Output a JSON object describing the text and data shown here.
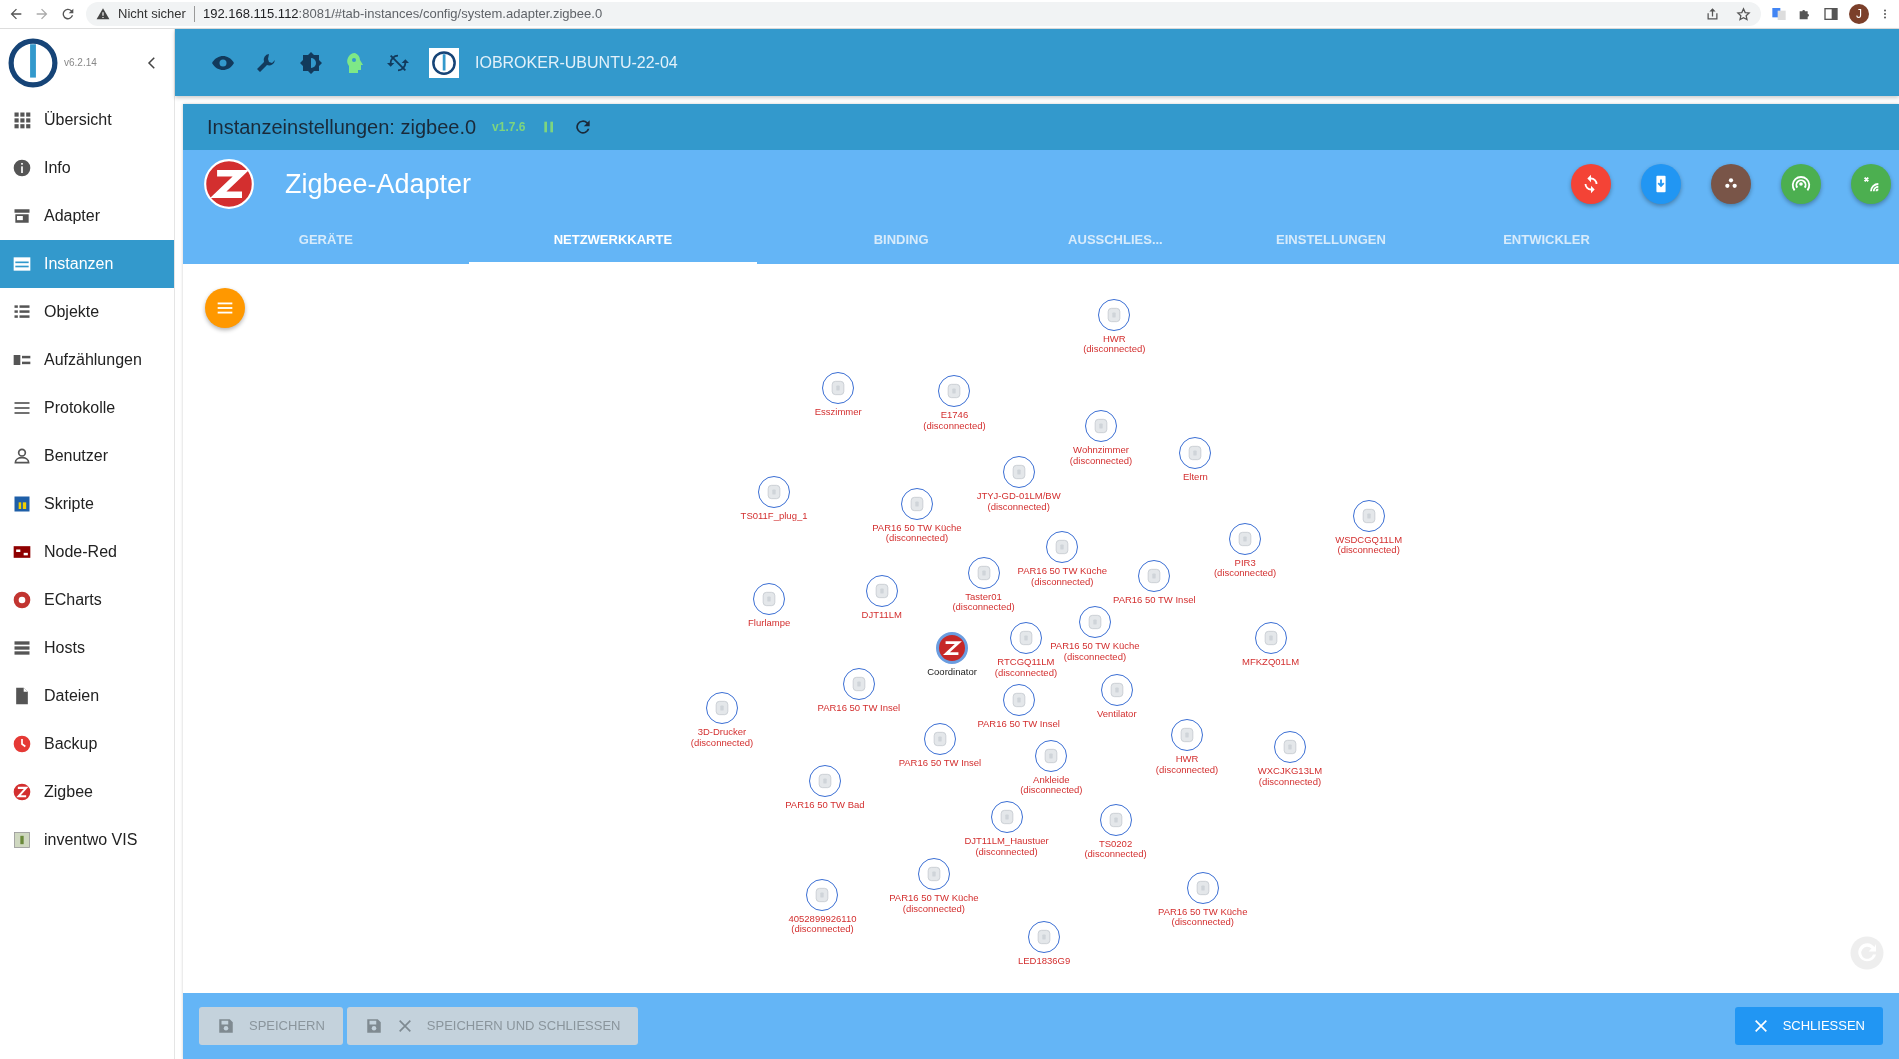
{
  "browser": {
    "security": "Nicht sicher",
    "url_host": "192.168.115.112",
    "url_path": ":8081/#tab-instances/config/system.adapter.zigbee.0",
    "profile_initial": "J"
  },
  "sidebar": {
    "version": "v6.2.14",
    "items": [
      {
        "label": "Übersicht",
        "selected": false
      },
      {
        "label": "Info",
        "selected": false
      },
      {
        "label": "Adapter",
        "selected": false
      },
      {
        "label": "Instanzen",
        "selected": true
      },
      {
        "label": "Objekte",
        "selected": false
      },
      {
        "label": "Aufzählungen",
        "selected": false
      },
      {
        "label": "Protokolle",
        "selected": false
      },
      {
        "label": "Benutzer",
        "selected": false
      },
      {
        "label": "Skripte",
        "selected": false
      },
      {
        "label": "Node-Red",
        "selected": false
      },
      {
        "label": "ECharts",
        "selected": false
      },
      {
        "label": "Hosts",
        "selected": false
      },
      {
        "label": "Dateien",
        "selected": false
      },
      {
        "label": "Backup",
        "selected": false
      },
      {
        "label": "Zigbee",
        "selected": false
      },
      {
        "label": "inventwo VIS",
        "selected": false
      }
    ]
  },
  "toolbar": {
    "host": "IOBROKER-UBUNTU-22-04"
  },
  "instance": {
    "title": "Instanzeinstellungen: zigbee.0",
    "version": "v1.7.6"
  },
  "adapter": {
    "title": "Zigbee-Adapter",
    "actions": [
      {
        "color": "#f44336"
      },
      {
        "color": "#2196f3"
      },
      {
        "color": "#795548"
      },
      {
        "color": "#4caf50"
      },
      {
        "color": "#4caf50"
      }
    ],
    "tabs": [
      {
        "label": "GERÄTE",
        "selected": false
      },
      {
        "label": "NETZWERKKARTE",
        "selected": true
      },
      {
        "label": "BINDING",
        "selected": false
      },
      {
        "label": "AUSSCHLIES...",
        "selected": false
      },
      {
        "label": "EINSTELLUNGEN",
        "selected": false
      },
      {
        "label": "ENTWICKLER",
        "selected": false
      }
    ]
  },
  "map": {
    "nodes": [
      {
        "kind": "device",
        "name": "HWR",
        "status": "(disconnected)"
      },
      {
        "kind": "device",
        "name": "Esszimmer"
      },
      {
        "kind": "device",
        "name": "E1746",
        "status": "(disconnected)"
      },
      {
        "kind": "device",
        "name": "Wohnzimmer",
        "status": "(disconnected)"
      },
      {
        "kind": "device",
        "name": "Eltern"
      },
      {
        "kind": "device",
        "name": "JTYJ-GD-01LM/BW",
        "status": "(disconnected)"
      },
      {
        "kind": "device",
        "name": "TS011F_plug_1"
      },
      {
        "kind": "device",
        "name": "PAR16 50 TW Küche",
        "status": "(disconnected)"
      },
      {
        "kind": "device",
        "name": "WSDCGQ11LM",
        "status": "(disconnected)"
      },
      {
        "kind": "device",
        "name": "PIR3",
        "status": "(disconnected)"
      },
      {
        "kind": "device",
        "name": "PAR16 50 TW Küche",
        "status": "(disconnected)"
      },
      {
        "kind": "device",
        "name": "Taster01",
        "status": "(disconnected)"
      },
      {
        "kind": "device",
        "name": "PAR16 50 TW Insel"
      },
      {
        "kind": "device",
        "name": "Flurlampe"
      },
      {
        "kind": "device",
        "name": "DJT11LM"
      },
      {
        "kind": "device",
        "name": "PAR16 50 TW Küche",
        "status": "(disconnected)"
      },
      {
        "kind": "device",
        "name": "MFKZQ01LM"
      },
      {
        "kind": "coordinator",
        "name": "Coordinator"
      },
      {
        "kind": "device",
        "name": "RTCGQ11LM",
        "status": "(disconnected)"
      },
      {
        "kind": "device",
        "name": "PAR16 50 TW Insel"
      },
      {
        "kind": "device",
        "name": "PAR16 50 TW Insel"
      },
      {
        "kind": "device",
        "name": "Ventilator"
      },
      {
        "kind": "device",
        "name": "3D-Drucker",
        "status": "(disconnected)"
      },
      {
        "kind": "device",
        "name": "PAR16 50 TW Insel"
      },
      {
        "kind": "device",
        "name": "HWR",
        "status": "(disconnected)"
      },
      {
        "kind": "device",
        "name": "Ankleide",
        "status": "(disconnected)"
      },
      {
        "kind": "device",
        "name": "WXCJKG13LM",
        "status": "(disconnected)"
      },
      {
        "kind": "device",
        "name": "PAR16 50 TW Bad"
      },
      {
        "kind": "device",
        "name": "DJT11LM_Haustuer",
        "status": "(disconnected)"
      },
      {
        "kind": "device",
        "name": "TS0202",
        "status": "(disconnected)"
      },
      {
        "kind": "device",
        "name": "PAR16 50 TW Küche",
        "status": "(disconnected)"
      },
      {
        "kind": "device",
        "name": "PAR16 50 TW Küche",
        "status": "(disconnected)"
      },
      {
        "kind": "device",
        "name": "4052899926110",
        "status": "(disconnected)"
      },
      {
        "kind": "device",
        "name": "LED1836G9"
      }
    ]
  },
  "footer": {
    "buttons": [
      {
        "label": "SPEICHERN",
        "disabled": true
      },
      {
        "label": "SPEICHERN UND SCHLIESSEN",
        "disabled": true
      },
      {
        "label": "SCHLIESSEN",
        "disabled": false
      }
    ]
  }
}
